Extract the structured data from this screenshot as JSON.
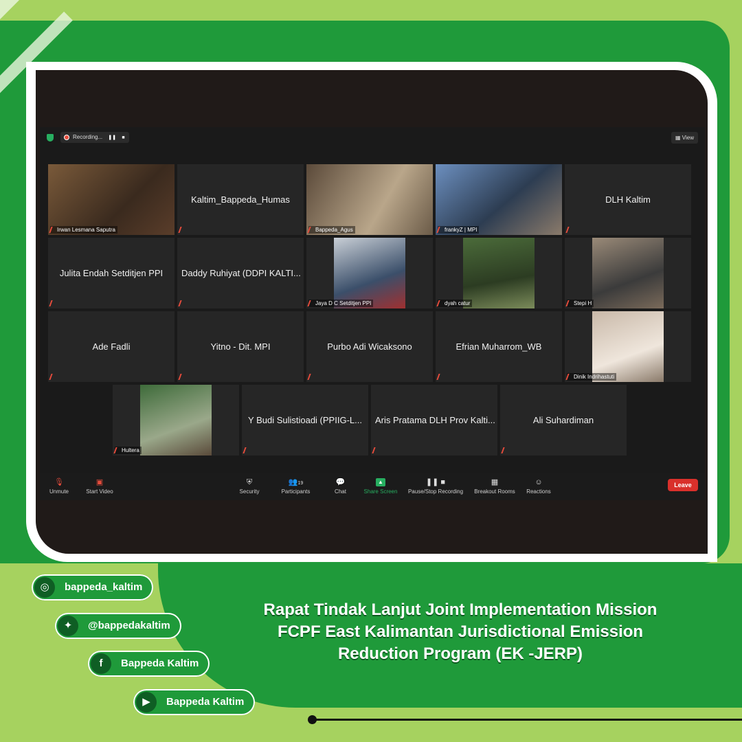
{
  "zoom": {
    "recording_label": "Recording...",
    "view_label": "View",
    "participants": [
      {
        "name": "Irwan Lesmana Saputra",
        "video": true
      },
      {
        "name": "Kaltim_Bappeda_Humas",
        "video": false
      },
      {
        "name": "Bappeda_Agus",
        "video": true
      },
      {
        "name": "frankyZ | MPI",
        "video": true,
        "active_speaker": true
      },
      {
        "name": "DLH Kaltim",
        "video": false
      },
      {
        "name": "Julita Endah Setditjen PPI",
        "video": false
      },
      {
        "name": "Daddy Ruhiyat (DDPI KALTI...",
        "video": false
      },
      {
        "name": "Jaya D C Setditjen PPI",
        "video": true
      },
      {
        "name": "dyah catur",
        "video": true
      },
      {
        "name": "Stepi H",
        "video": true
      },
      {
        "name": "Ade Fadli",
        "video": false
      },
      {
        "name": "Yitno - Dit. MPI",
        "video": false
      },
      {
        "name": "Purbo Adi Wicaksono",
        "video": false
      },
      {
        "name": "Efrian Muharrom_WB",
        "video": false
      },
      {
        "name": "Dinik Indrihastuti",
        "video": true
      },
      {
        "name": "Hultera",
        "video": true
      },
      {
        "name": "Y Budi Sulistioadi (PPIIG-L...",
        "video": false
      },
      {
        "name": "Aris Pratama DLH Prov Kalti...",
        "video": false
      },
      {
        "name": "Ali Suhardiman",
        "video": false
      }
    ],
    "toolbar": {
      "unmute": "Unmute",
      "start_video": "Start Video",
      "security": "Security",
      "participants": "Participants",
      "participants_count": "19",
      "chat": "Chat",
      "share_screen": "Share Screen",
      "pause_recording": "Pause/Stop Recording",
      "breakout_rooms": "Breakout Rooms",
      "reactions": "Reactions",
      "leave": "Leave"
    }
  },
  "social": {
    "instagram": "bappeda_kaltim",
    "twitter": "@bappedakaltim",
    "facebook": "Bappeda Kaltim",
    "youtube": "Bappeda Kaltim"
  },
  "title": {
    "line1": "Rapat Tindak Lanjut Joint Implementation Mission",
    "line2": "FCPF East Kalimantan Jurisdictional Emission",
    "line3": "Reduction Program (EK -JERP)"
  },
  "colors": {
    "brand_green": "#1f9a3a",
    "light_green": "#a6d25f",
    "leave_red": "#d9302b",
    "share_green": "#27ae60"
  }
}
